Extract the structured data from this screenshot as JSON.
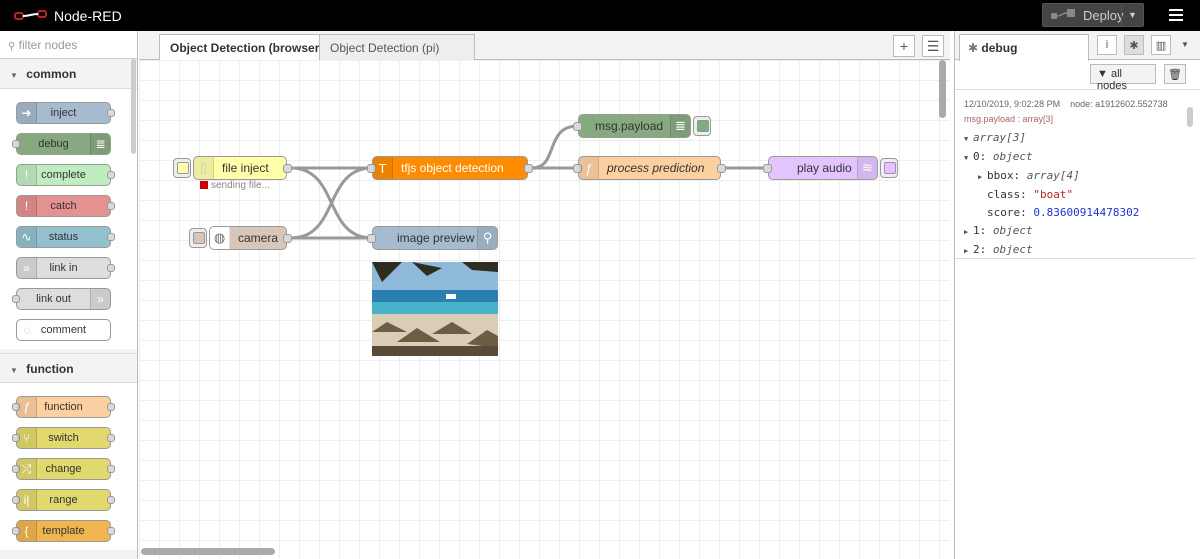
{
  "header": {
    "app_title": "Node-RED",
    "deploy_label": "Deploy"
  },
  "palette": {
    "filter_placeholder": "filter nodes",
    "categories": [
      {
        "name": "common",
        "nodes": [
          {
            "label": "inject",
            "color": "#a6bbcf"
          },
          {
            "label": "debug",
            "color": "#87a980"
          },
          {
            "label": "complete",
            "color": "#c0edc0"
          },
          {
            "label": "catch",
            "color": "#e49191"
          },
          {
            "label": "status",
            "color": "#94c1d0"
          },
          {
            "label": "link in",
            "color": "#dddddd"
          },
          {
            "label": "link out",
            "color": "#dddddd"
          },
          {
            "label": "comment",
            "color": "#ffffff"
          }
        ]
      },
      {
        "name": "function",
        "nodes": [
          {
            "label": "function",
            "color": "#fdd0a2"
          },
          {
            "label": "switch",
            "color": "#e2d96e"
          },
          {
            "label": "change",
            "color": "#e2d96e"
          },
          {
            "label": "range",
            "color": "#e2d96e"
          },
          {
            "label": "template",
            "color": "#f0b54e"
          }
        ]
      }
    ]
  },
  "workspace": {
    "tabs": [
      {
        "label": "Object Detection (browser)",
        "active": true
      },
      {
        "label": "Object Detection (pi)",
        "active": false
      }
    ],
    "flow_nodes": {
      "file_inject": {
        "label": "file inject",
        "color": "#ffffaa",
        "status": "sending file..."
      },
      "camera": {
        "label": "camera",
        "color": "#d8c6b8"
      },
      "tfjs": {
        "label": "tfjs object detection",
        "color": "#ff8c00"
      },
      "msg_payload": {
        "label": "msg.payload",
        "color": "#87a980"
      },
      "process": {
        "label": "process prediction",
        "color": "#fdd0a2"
      },
      "play_audio": {
        "label": "play audio",
        "color": "#e2c4ff"
      },
      "image_preview": {
        "label": "image preview",
        "color": "#a6bbcf"
      }
    }
  },
  "sidebar": {
    "tab_label": "debug",
    "all_nodes_label": "all nodes",
    "message": {
      "timestamp": "12/10/2019, 9:02:28 PM",
      "node": "node: a1912602.552738",
      "topic": "msg.payload : array[3]",
      "root": "array[3]",
      "item0": "0",
      "item0_type": "object",
      "bbox_key": "bbox",
      "bbox_type": "array[4]",
      "class_key": "class",
      "class_value": "\"boat\"",
      "score_key": "score",
      "score_value": "0.83600914478302",
      "item1": "1",
      "item1_type": "object",
      "item2": "2",
      "item2_type": "object"
    }
  }
}
